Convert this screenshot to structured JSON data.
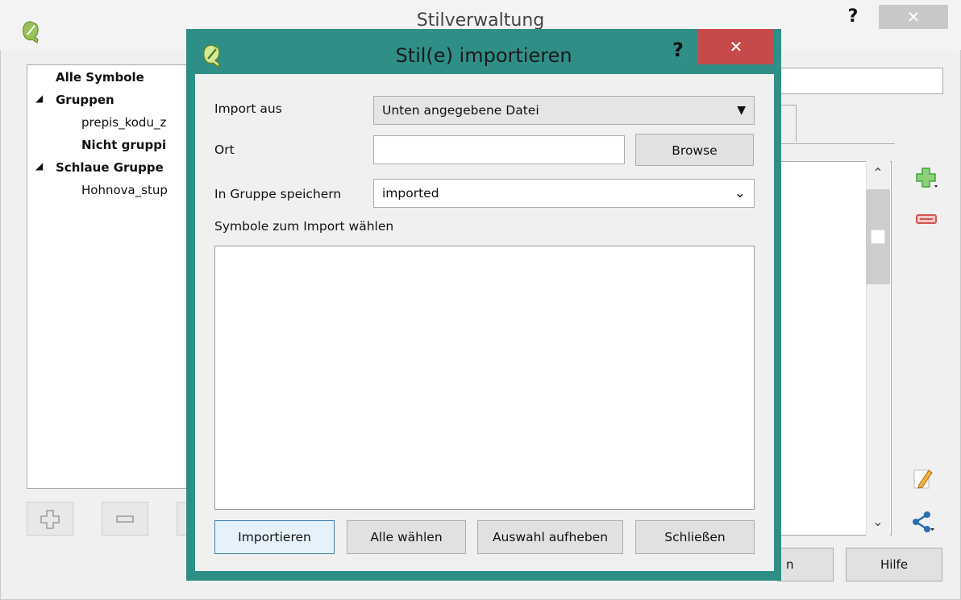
{
  "background_window": {
    "title": "Stilverwaltung",
    "help_label": "?",
    "close_label": "✕",
    "tree": {
      "all_symbols": "Alle Symbole",
      "groups_toggle": "◢",
      "groups": "Gruppen",
      "group_child": "prepis_kodu_z",
      "ungrouped": "Nicht gruppi",
      "smart_toggle": "◢",
      "smart_groups": "Schlaue Gruppe",
      "smart_child": "Hohnova_stup"
    },
    "scroll_up": "⌃",
    "scroll_down": "⌄",
    "partial_button": "n",
    "help_button": "Hilfe"
  },
  "dialog": {
    "title": "Stil(e) importieren",
    "help_label": "?",
    "close_label": "✕",
    "import_from_label": "Import aus",
    "import_from_value": "Unten angegebene Datei",
    "location_label": "Ort",
    "location_value": "",
    "browse_label": "Browse",
    "save_group_label": "In Gruppe speichern",
    "save_group_value": "imported",
    "select_symbols_label": "Symbole zum Import wählen",
    "buttons": {
      "import": "Importieren",
      "select_all": "Alle wählen",
      "deselect": "Auswahl aufheben",
      "close": "Schließen"
    }
  },
  "colors": {
    "dialog_frame": "#2f8f87",
    "close_red": "#c74a4a",
    "add_green": "#3aa635",
    "remove_red": "#d9534f"
  }
}
